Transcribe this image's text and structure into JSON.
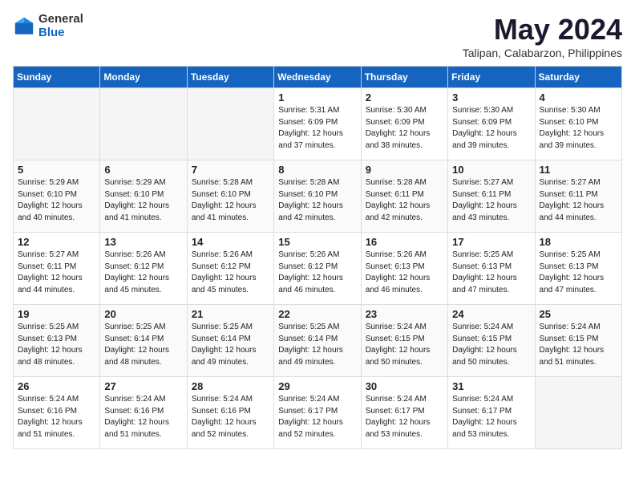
{
  "header": {
    "logo_general": "General",
    "logo_blue": "Blue",
    "month_title": "May 2024",
    "location": "Talipan, Calabarzon, Philippines"
  },
  "days_of_week": [
    "Sunday",
    "Monday",
    "Tuesday",
    "Wednesday",
    "Thursday",
    "Friday",
    "Saturday"
  ],
  "weeks": [
    [
      {
        "day": "",
        "empty": true
      },
      {
        "day": "",
        "empty": true
      },
      {
        "day": "",
        "empty": true
      },
      {
        "day": "1",
        "sunrise": "5:31 AM",
        "sunset": "6:09 PM",
        "daylight": "12 hours and 37 minutes."
      },
      {
        "day": "2",
        "sunrise": "5:30 AM",
        "sunset": "6:09 PM",
        "daylight": "12 hours and 38 minutes."
      },
      {
        "day": "3",
        "sunrise": "5:30 AM",
        "sunset": "6:09 PM",
        "daylight": "12 hours and 39 minutes."
      },
      {
        "day": "4",
        "sunrise": "5:30 AM",
        "sunset": "6:10 PM",
        "daylight": "12 hours and 39 minutes."
      }
    ],
    [
      {
        "day": "5",
        "sunrise": "5:29 AM",
        "sunset": "6:10 PM",
        "daylight": "12 hours and 40 minutes."
      },
      {
        "day": "6",
        "sunrise": "5:29 AM",
        "sunset": "6:10 PM",
        "daylight": "12 hours and 41 minutes."
      },
      {
        "day": "7",
        "sunrise": "5:28 AM",
        "sunset": "6:10 PM",
        "daylight": "12 hours and 41 minutes."
      },
      {
        "day": "8",
        "sunrise": "5:28 AM",
        "sunset": "6:10 PM",
        "daylight": "12 hours and 42 minutes."
      },
      {
        "day": "9",
        "sunrise": "5:28 AM",
        "sunset": "6:11 PM",
        "daylight": "12 hours and 42 minutes."
      },
      {
        "day": "10",
        "sunrise": "5:27 AM",
        "sunset": "6:11 PM",
        "daylight": "12 hours and 43 minutes."
      },
      {
        "day": "11",
        "sunrise": "5:27 AM",
        "sunset": "6:11 PM",
        "daylight": "12 hours and 44 minutes."
      }
    ],
    [
      {
        "day": "12",
        "sunrise": "5:27 AM",
        "sunset": "6:11 PM",
        "daylight": "12 hours and 44 minutes."
      },
      {
        "day": "13",
        "sunrise": "5:26 AM",
        "sunset": "6:12 PM",
        "daylight": "12 hours and 45 minutes."
      },
      {
        "day": "14",
        "sunrise": "5:26 AM",
        "sunset": "6:12 PM",
        "daylight": "12 hours and 45 minutes."
      },
      {
        "day": "15",
        "sunrise": "5:26 AM",
        "sunset": "6:12 PM",
        "daylight": "12 hours and 46 minutes."
      },
      {
        "day": "16",
        "sunrise": "5:26 AM",
        "sunset": "6:13 PM",
        "daylight": "12 hours and 46 minutes."
      },
      {
        "day": "17",
        "sunrise": "5:25 AM",
        "sunset": "6:13 PM",
        "daylight": "12 hours and 47 minutes."
      },
      {
        "day": "18",
        "sunrise": "5:25 AM",
        "sunset": "6:13 PM",
        "daylight": "12 hours and 47 minutes."
      }
    ],
    [
      {
        "day": "19",
        "sunrise": "5:25 AM",
        "sunset": "6:13 PM",
        "daylight": "12 hours and 48 minutes."
      },
      {
        "day": "20",
        "sunrise": "5:25 AM",
        "sunset": "6:14 PM",
        "daylight": "12 hours and 48 minutes."
      },
      {
        "day": "21",
        "sunrise": "5:25 AM",
        "sunset": "6:14 PM",
        "daylight": "12 hours and 49 minutes."
      },
      {
        "day": "22",
        "sunrise": "5:25 AM",
        "sunset": "6:14 PM",
        "daylight": "12 hours and 49 minutes."
      },
      {
        "day": "23",
        "sunrise": "5:24 AM",
        "sunset": "6:15 PM",
        "daylight": "12 hours and 50 minutes."
      },
      {
        "day": "24",
        "sunrise": "5:24 AM",
        "sunset": "6:15 PM",
        "daylight": "12 hours and 50 minutes."
      },
      {
        "day": "25",
        "sunrise": "5:24 AM",
        "sunset": "6:15 PM",
        "daylight": "12 hours and 51 minutes."
      }
    ],
    [
      {
        "day": "26",
        "sunrise": "5:24 AM",
        "sunset": "6:16 PM",
        "daylight": "12 hours and 51 minutes."
      },
      {
        "day": "27",
        "sunrise": "5:24 AM",
        "sunset": "6:16 PM",
        "daylight": "12 hours and 51 minutes."
      },
      {
        "day": "28",
        "sunrise": "5:24 AM",
        "sunset": "6:16 PM",
        "daylight": "12 hours and 52 minutes."
      },
      {
        "day": "29",
        "sunrise": "5:24 AM",
        "sunset": "6:17 PM",
        "daylight": "12 hours and 52 minutes."
      },
      {
        "day": "30",
        "sunrise": "5:24 AM",
        "sunset": "6:17 PM",
        "daylight": "12 hours and 53 minutes."
      },
      {
        "day": "31",
        "sunrise": "5:24 AM",
        "sunset": "6:17 PM",
        "daylight": "12 hours and 53 minutes."
      },
      {
        "day": "",
        "empty": true
      }
    ]
  ]
}
